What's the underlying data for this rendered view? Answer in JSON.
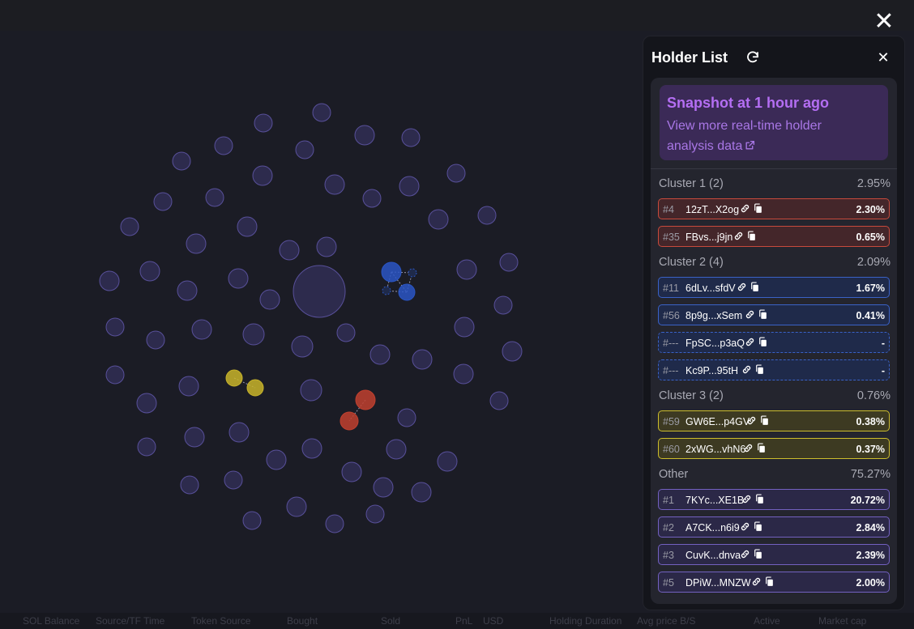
{
  "window": {
    "close_icon": "close-icon"
  },
  "bubble_map": {
    "background": "#1b1c25",
    "bubble_fill": "#2d2b4d",
    "bubble_stroke": "#58509a",
    "cluster_colors": {
      "blue": "#2a55c4",
      "yellow": "#c8b42a",
      "red": "#c0402f"
    }
  },
  "panel": {
    "title": "Holder List",
    "refresh_icon": "refresh-icon",
    "close_icon": "close-icon",
    "snapshot": {
      "title": "Snapshot at 1 hour ago",
      "link_text": "View more real-time holder analysis data",
      "link_icon": "external-link-icon"
    },
    "groups": [
      {
        "label": "Cluster 1 (2)",
        "percent": "2.95%",
        "color": "red",
        "rows": [
          {
            "rank": "#4",
            "address": "12zT...X2og",
            "percent": "2.30%"
          },
          {
            "rank": "#35",
            "address": "FBvs...j9jn",
            "percent": "0.65%"
          }
        ]
      },
      {
        "label": "Cluster 2 (4)",
        "percent": "2.09%",
        "color": "blue",
        "rows": [
          {
            "rank": "#11",
            "address": "6dLv...sfdV",
            "percent": "1.67%"
          },
          {
            "rank": "#56",
            "address": "8p9g...xSem",
            "percent": "0.41%"
          },
          {
            "rank": "#---",
            "address": "FpSC...p3aQ",
            "percent": "-",
            "dashed": true
          },
          {
            "rank": "#---",
            "address": "Kc9P...95tH",
            "percent": "-",
            "dashed": true
          }
        ]
      },
      {
        "label": "Cluster 3 (2)",
        "percent": "0.76%",
        "color": "yellow",
        "rows": [
          {
            "rank": "#59",
            "address": "GW6E...p4GV",
            "percent": "0.38%"
          },
          {
            "rank": "#60",
            "address": "2xWG...vhN6",
            "percent": "0.37%"
          }
        ]
      },
      {
        "label": "Other",
        "percent": "75.27%",
        "color": "purple",
        "rows": [
          {
            "rank": "#1",
            "address": "7KYc...XE1B",
            "percent": "20.72%"
          },
          {
            "rank": "#2",
            "address": "A7CK...n6i9",
            "percent": "2.84%"
          },
          {
            "rank": "#3",
            "address": "CuvK...dnva",
            "percent": "2.39%"
          },
          {
            "rank": "#5",
            "address": "DPiW...MNZW",
            "percent": "2.00%"
          }
        ]
      }
    ]
  },
  "background_table_headers": [
    "SOL Balance",
    "Source/TF Time",
    "Token Source",
    "Bought",
    "Sold",
    "PnL",
    "USD",
    "Holding Duration",
    "Avg price B/S",
    "Active",
    "Market cap"
  ]
}
